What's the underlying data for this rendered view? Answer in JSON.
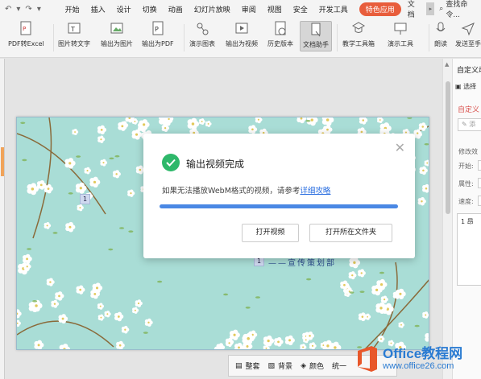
{
  "menubar": {
    "items": [
      "开始",
      "插入",
      "设计",
      "切换",
      "动画",
      "幻灯片放映",
      "审阅",
      "视图",
      "安全",
      "开发工具"
    ],
    "active_item": "特色应用",
    "more_item": "文档",
    "search_label": "查找命令..."
  },
  "toolbar": {
    "pdf_to_excel": "PDF转Excel",
    "img_to_text": "图片转文字",
    "export_image": "输出为图片",
    "export_pdf": "输出为PDF",
    "demo_chart": "演示图表",
    "export_video": "输出为视频",
    "history": "历史版本",
    "doc_helper": "文档助手",
    "teach_tools": "教学工具箱",
    "demo_tools": "演示工具",
    "read_aloud": "朗读",
    "send_to": "发送至手"
  },
  "right_panel": {
    "title": "自定义动",
    "select_label": "选择",
    "custom_label": "自定义",
    "add_button": "添",
    "modify_label": "修改效",
    "start_label": "开始:",
    "property_label": "属性:",
    "speed_label": "速度:",
    "list_item": "1 昂"
  },
  "slide": {
    "number_badge_1": "1",
    "number_badge_2": "1",
    "subtitle": "——宣传策划部"
  },
  "dialog": {
    "title": "输出视频完成",
    "message": "如果无法播放WebM格式的视频，请参考",
    "link": "详细攻略",
    "progress": 1.0,
    "open_video": "打开视频",
    "open_folder": "打开所在文件夹"
  },
  "bottom_bar": {
    "set": "整套",
    "background": "背景",
    "color": "颜色",
    "more": "统一"
  },
  "watermark": {
    "brand": "Office教程网",
    "url": "www.office26.com"
  },
  "colors": {
    "accent": "#e85d3c",
    "success": "#2eb86a",
    "progress": "#4a88e4",
    "link": "#2a6ee0",
    "slide_bg": "#a9ddd6"
  }
}
